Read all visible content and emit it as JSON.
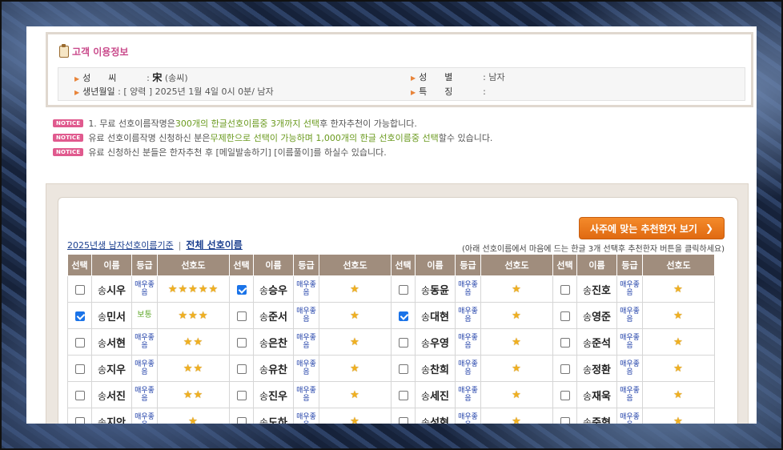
{
  "customer": {
    "title": "고객 이용정보",
    "surname_label": "성　　씨",
    "surname_hanja": "宋",
    "surname_hangul": "(송씨)",
    "birth_label": "생년월일",
    "birth_value": "[ 양력 ] 2025년 1월 4일 0시 0분/ 남자",
    "gender_label": "성　　별",
    "gender_value": "남자",
    "feature_label": "특　　징",
    "feature_value": ""
  },
  "notices": {
    "badge": "NOTICE",
    "n1": {
      "pre": "1. 무료 선호이름작명은 ",
      "hl": "300개의 한글선호이름중 3개까지 선택",
      "post": "후 한자추천이 가능합니다."
    },
    "n2": {
      "pre": "유료 선호이름작명 신청하신 분은",
      "hl": "무제한으로 선택이 가능하며 1,000개의 한글 선호이름중 선택",
      "post": "할수 있습니다."
    },
    "n3": {
      "text": "유료 신청하신 분들은 한자추천 후 [메일발송하기] [이름풀이]를 하실수 있습니다."
    }
  },
  "results": {
    "recommend_button": "사주에 맞는 추천한자 보기",
    "link_year": "2025년생 남자선호이름기준",
    "link_all": "전체 선호이름",
    "hint": "(아래 선호이름에서 마음에 드는 한글 3개 선택후 추천한자 버튼을 클릭하세요)",
    "headers": {
      "select": "선택",
      "name": "이름",
      "grade": "등급",
      "pref": "선호도"
    },
    "grade_best": "매우좋음",
    "grade_normal": "보통"
  },
  "rows": [
    [
      {
        "s": "송",
        "g": "시우",
        "c": false,
        "gr": "매우좋음",
        "st": 5
      },
      {
        "s": "송",
        "g": "승우",
        "c": true,
        "gr": "매우좋음",
        "st": 1
      },
      {
        "s": "송",
        "g": "동윤",
        "c": false,
        "gr": "매우좋음",
        "st": 1
      },
      {
        "s": "송",
        "g": "진호",
        "c": false,
        "gr": "매우좋음",
        "st": 1
      }
    ],
    [
      {
        "s": "송",
        "g": "민서",
        "c": true,
        "gr": "보통",
        "st": 3
      },
      {
        "s": "송",
        "g": "준서",
        "c": false,
        "gr": "매우좋음",
        "st": 1
      },
      {
        "s": "송",
        "g": "대현",
        "c": true,
        "gr": "매우좋음",
        "st": 1
      },
      {
        "s": "송",
        "g": "영준",
        "c": false,
        "gr": "매우좋음",
        "st": 1
      }
    ],
    [
      {
        "s": "송",
        "g": "서현",
        "c": false,
        "gr": "매우좋음",
        "st": 2
      },
      {
        "s": "송",
        "g": "은찬",
        "c": false,
        "gr": "매우좋음",
        "st": 1
      },
      {
        "s": "송",
        "g": "우영",
        "c": false,
        "gr": "매우좋음",
        "st": 1
      },
      {
        "s": "송",
        "g": "준석",
        "c": false,
        "gr": "매우좋음",
        "st": 1
      }
    ],
    [
      {
        "s": "송",
        "g": "지우",
        "c": false,
        "gr": "매우좋음",
        "st": 2
      },
      {
        "s": "송",
        "g": "유찬",
        "c": false,
        "gr": "매우좋음",
        "st": 1
      },
      {
        "s": "송",
        "g": "찬희",
        "c": false,
        "gr": "매우좋음",
        "st": 1
      },
      {
        "s": "송",
        "g": "정환",
        "c": false,
        "gr": "매우좋음",
        "st": 1
      }
    ],
    [
      {
        "s": "송",
        "g": "서진",
        "c": false,
        "gr": "매우좋음",
        "st": 2
      },
      {
        "s": "송",
        "g": "진우",
        "c": false,
        "gr": "매우좋음",
        "st": 1
      },
      {
        "s": "송",
        "g": "세진",
        "c": false,
        "gr": "매우좋음",
        "st": 1
      },
      {
        "s": "송",
        "g": "재욱",
        "c": false,
        "gr": "매우좋음",
        "st": 1
      }
    ],
    [
      {
        "s": "송",
        "g": "지안",
        "c": false,
        "gr": "매우좋음",
        "st": 1
      },
      {
        "s": "송",
        "g": "도하",
        "c": false,
        "gr": "매우좋음",
        "st": 1
      },
      {
        "s": "송",
        "g": "성현",
        "c": false,
        "gr": "매우좋음",
        "st": 1
      },
      {
        "s": "송",
        "g": "준형",
        "c": false,
        "gr": "매우좋음",
        "st": 1
      }
    ]
  ]
}
